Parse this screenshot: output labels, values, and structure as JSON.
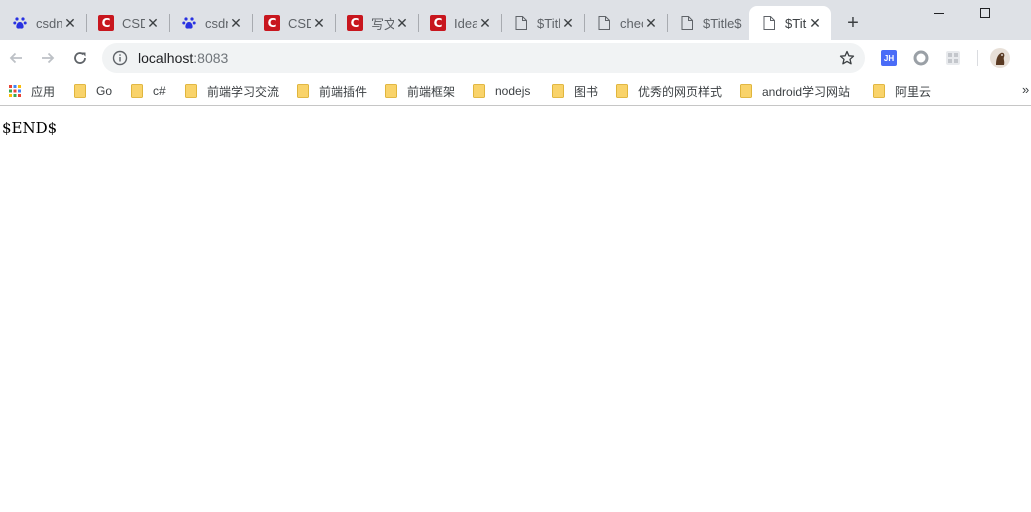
{
  "tabs": [
    {
      "title": "csdn",
      "favicon": "baidu-paw-icon",
      "active": false
    },
    {
      "title": "CSDN",
      "favicon": "csdn-logo-icon",
      "active": false
    },
    {
      "title": "csdn",
      "favicon": "baidu-paw-icon",
      "active": false
    },
    {
      "title": "CSDN",
      "favicon": "csdn-logo-icon",
      "active": false
    },
    {
      "title": "写文章",
      "favicon": "csdn-logo-icon",
      "active": false
    },
    {
      "title": "Idea",
      "favicon": "csdn-logo-icon",
      "active": false
    },
    {
      "title": "$Title$",
      "favicon": "document-icon",
      "active": false
    },
    {
      "title": "checkbox",
      "favicon": "document-icon",
      "active": false
    },
    {
      "title": "$Title$",
      "favicon": "document-icon",
      "active": false
    },
    {
      "title": "$Title$",
      "favicon": "document-icon",
      "active": true
    }
  ],
  "tab_close_glyph": "✕",
  "new_tab_glyph": "+",
  "omnibox": {
    "host": "localhost",
    "port": ":8083"
  },
  "bookmarks": {
    "apps_label": "应用",
    "items": [
      "Go",
      "c#",
      "前端学习交流",
      "前端插件",
      "前端框架",
      "nodejs",
      "图书",
      "优秀的网页样式",
      "android学习网站",
      "阿里云"
    ],
    "overflow_glyph": "»"
  },
  "page": {
    "text": "$END$"
  },
  "colors": {
    "tabstrip_bg": "#dee1e6",
    "omnibox_bg": "#f1f3f4",
    "csdn_red": "#c8161e",
    "baidu_blue": "#2932e1",
    "folder_yellow": "#f9d36a"
  }
}
